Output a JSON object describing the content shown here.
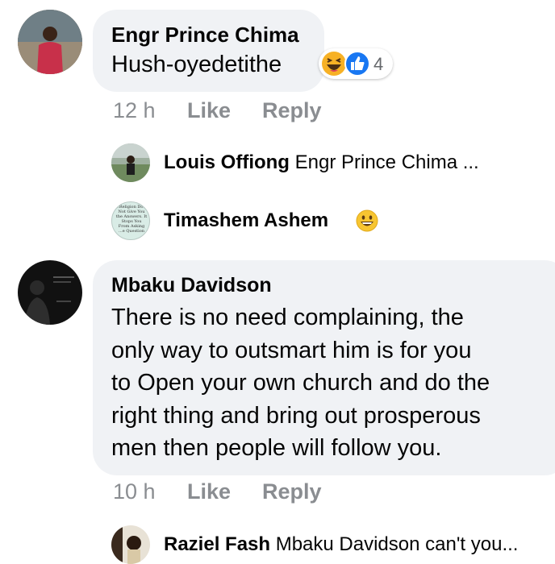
{
  "comments": [
    {
      "author": "Engr Prince Chima",
      "text": "Hush-oyedetithe",
      "reaction_count": "4",
      "reactions": [
        "haha-icon",
        "like-icon"
      ],
      "time": "12 h",
      "like_label": "Like",
      "reply_label": "Reply",
      "replies": [
        {
          "author": "Louis Offiong",
          "preview": "Engr Prince Chima ..."
        },
        {
          "author": "Timashem Ashem",
          "preview": "",
          "emoji": "grinning-face-icon"
        }
      ]
    },
    {
      "author": "Mbaku Davidson",
      "text_lines": [
        "There is no need complaining, the",
        "only way to outsmart him is for you",
        "to Open your own church and do the",
        "right thing and bring out prosperous",
        "men then people will follow you."
      ],
      "time": "10 h",
      "like_label": "Like",
      "reply_label": "Reply",
      "replies": [
        {
          "author": "Raziel Fash",
          "preview": "Mbaku Davidson can't you..."
        }
      ]
    }
  ],
  "avatar_text": {
    "timashem": [
      "...Religion Does",
      "Not Give You",
      "the Answers. It",
      "Stops You",
      "From Asking",
      "...e Question"
    ]
  },
  "colors": {
    "bubble": "#f0f2f5",
    "meta": "#8a8d91",
    "like_blue": "#1877f2",
    "haha_yellow": "#f7b125"
  }
}
